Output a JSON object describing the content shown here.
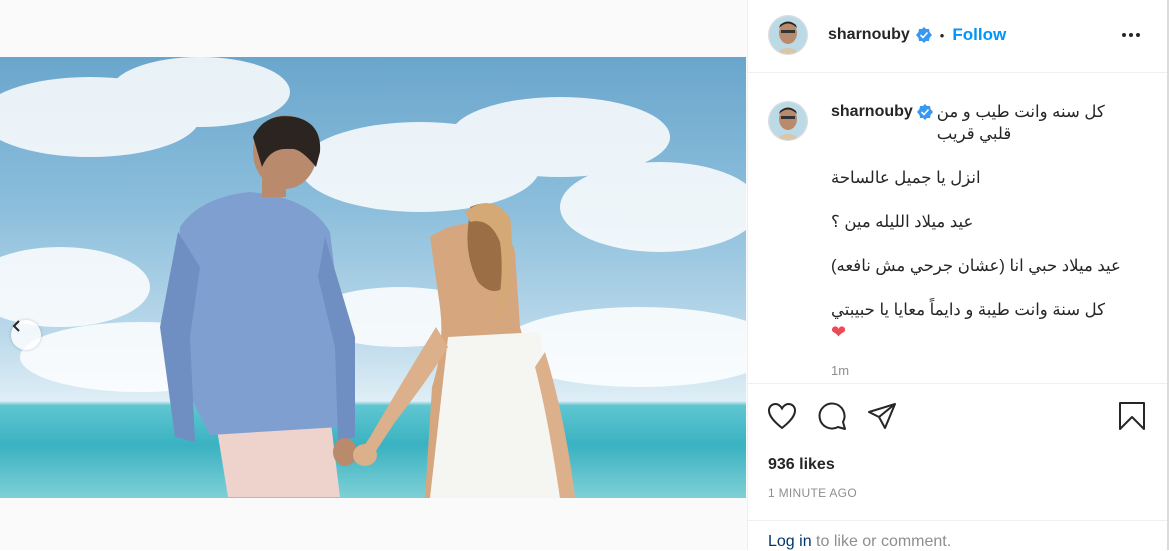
{
  "post": {
    "username": "sharnouby",
    "follow_label": "Follow",
    "separator": "•",
    "caption_lines": [
      "كل سنه وانت طيب و من قلبي قريب",
      "",
      "انزل يا جميل عالساحة",
      "",
      "عيد ميلاد الليله مين ؟",
      "",
      "عيد ميلاد حبي انا (عشان جرحي مش نافعه)",
      "",
      "كل سنة وانت طيبة و دايماً معايا يا حبيبتي"
    ],
    "caption_emoji": "❤",
    "relative_time": "1m",
    "likes": "936 likes",
    "absolute_time": "1 MINUTE AGO",
    "login_link": "Log in",
    "login_rest": " to like or comment."
  },
  "icons": {
    "verified": "verified-badge-icon",
    "more": "more-options-icon",
    "like": "heart-icon",
    "comment": "comment-icon",
    "share": "share-icon",
    "save": "bookmark-icon",
    "prev": "chevron-left-icon"
  },
  "carousel": {
    "slides": 2,
    "active": 2
  },
  "colors": {
    "follow": "#0095f6",
    "verified": "#3897f0",
    "muted": "#8e8e8e",
    "heart": "#ed4956"
  }
}
